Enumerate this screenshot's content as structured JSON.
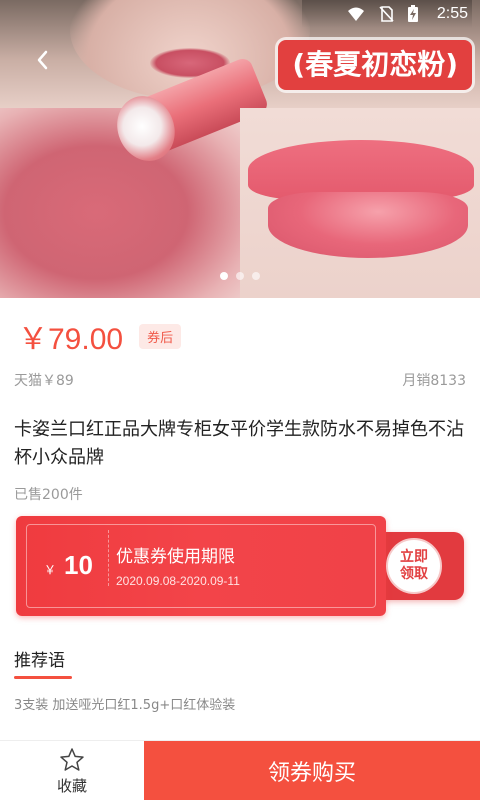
{
  "status_bar": {
    "time": "2:55",
    "icons": [
      "wifi-icon",
      "no-sim-icon",
      "battery-charging-icon"
    ]
  },
  "hero": {
    "banner_text": "(春夏初恋粉)",
    "carousel": {
      "total": 3,
      "active": 1
    }
  },
  "product": {
    "price": "￥79.00",
    "coupon_tag": "券后",
    "original_price": "天猫￥89",
    "monthly_sales": "月销8133",
    "title": "卡姿兰口红正品大牌专柜女平价学生款防水不易掉色不沾杯小众品牌",
    "sold": "已售200件"
  },
  "coupon": {
    "currency": "￥",
    "amount": "10",
    "title": "优惠券使用期限",
    "dates": "2020.09.08-2020.09-11",
    "claim_line1": "立即",
    "claim_line2": "领取"
  },
  "recommend": {
    "title": "推荐语",
    "text": "3支装 加送哑光口红1.5g+口红体验装"
  },
  "bottom": {
    "favorite_label": "收藏",
    "buy_label": "领券购买"
  },
  "colors": {
    "accent": "#f4503f",
    "coupon_red": "#ef3b3f"
  }
}
